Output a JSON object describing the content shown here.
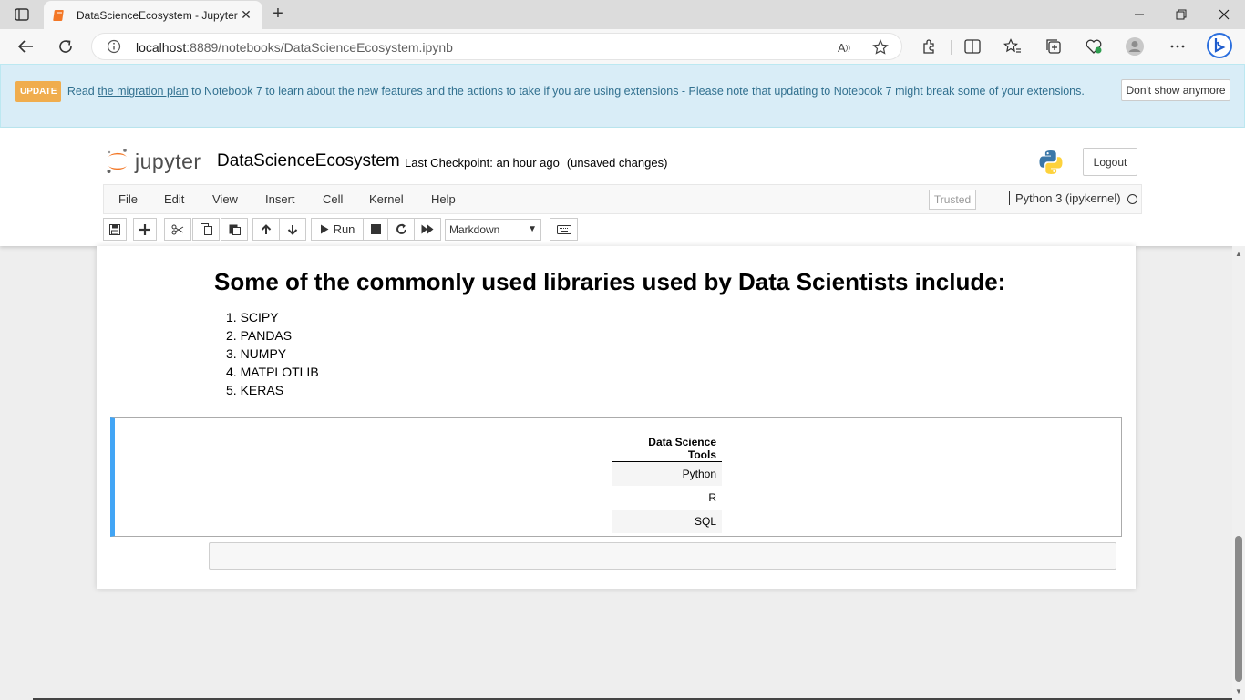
{
  "browser": {
    "tab_title": "DataScienceEcosystem - Jupyter",
    "url_host": "localhost",
    "url_rest": ":8889/notebooks/DataScienceEcosystem.ipynb"
  },
  "banner": {
    "badge": "UPDATE",
    "text_before": "Read ",
    "link": "the migration plan",
    "text_after": " to Notebook 7 to learn about the new features and the actions to take if you are using extensions - Please note that updating to Notebook 7 might break some of your extensions.",
    "dismiss_label": "Don't show anymore"
  },
  "header": {
    "logo_text": "jupyter",
    "notebook_title": "DataScienceEcosystem",
    "checkpoint": "Last Checkpoint: an hour ago",
    "unsaved": "(unsaved changes)",
    "logout_label": "Logout"
  },
  "menu": {
    "items": [
      "File",
      "Edit",
      "View",
      "Insert",
      "Cell",
      "Kernel",
      "Help"
    ],
    "trusted": "Trusted",
    "kernel": "Python 3 (ipykernel)"
  },
  "toolbar": {
    "run_label": "Run",
    "cell_type": "Markdown"
  },
  "notebook": {
    "heading": "Some of the commonly used libraries used by Data Scientists include:",
    "libraries": [
      "1. SCIPY",
      "2. PANDAS",
      "3. NUMPY",
      "4. MATPLOTLIB",
      "5. KERAS"
    ],
    "table_header": "Data Science Tools",
    "table_rows": [
      "Python",
      "R",
      "SQL"
    ]
  },
  "colors": {
    "accent_cell": "#42a5f5",
    "banner_bg": "#d9edf7",
    "badge": "#f0ad4e"
  }
}
